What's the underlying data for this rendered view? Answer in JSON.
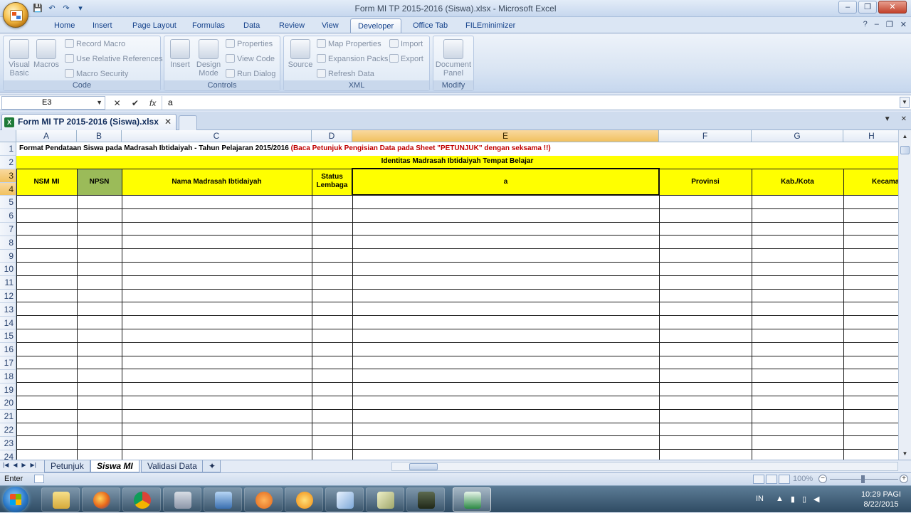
{
  "window": {
    "title": "Form MI TP 2015-2016 (Siswa).xlsx - Microsoft Excel",
    "qat_save": "💾",
    "qat_undo": "↶",
    "qat_redo": "↷",
    "qat_more": "▾",
    "minimize": "–",
    "restore": "❐",
    "close": "✕"
  },
  "ribbon_tabs": [
    "Home",
    "Insert",
    "Page Layout",
    "Formulas",
    "Data",
    "Review",
    "View",
    "Developer",
    "Office Tab",
    "FILEminimizer"
  ],
  "active_tab": "Developer",
  "ribbon": {
    "code": {
      "label": "Code",
      "visual_basic": "Visual Basic",
      "macros": "Macros",
      "record_macro": "Record Macro",
      "relative_refs": "Use Relative References",
      "macro_security": "Macro Security"
    },
    "controls": {
      "label": "Controls",
      "insert": "Insert",
      "design_mode": "Design Mode",
      "properties": "Properties",
      "view_code": "View Code",
      "run_dialog": "Run Dialog"
    },
    "xml": {
      "label": "XML",
      "source": "Source",
      "map_properties": "Map Properties",
      "expansion_packs": "Expansion Packs",
      "refresh_data": "Refresh Data",
      "import": "Import",
      "export": "Export"
    },
    "modify": {
      "label": "Modify",
      "document_panel": "Document Panel"
    }
  },
  "formula_bar": {
    "name_box": "E3",
    "value": "a",
    "fx": "fx",
    "cancel": "✕",
    "enter": "✔"
  },
  "doc_tab": {
    "label": "Form MI TP 2015-2016 (Siswa).xlsx",
    "close": "✕"
  },
  "columns": [
    "A",
    "B",
    "C",
    "D",
    "E",
    "F",
    "G",
    "H"
  ],
  "selected_column": "E",
  "rows": [
    "1",
    "2",
    "3",
    "4",
    "5",
    "6",
    "7",
    "8",
    "9",
    "10",
    "11",
    "12",
    "13",
    "14",
    "15",
    "16",
    "17",
    "18",
    "19",
    "20",
    "21",
    "22",
    "23",
    "24"
  ],
  "selected_rows": [
    "3",
    "4"
  ],
  "sheet": {
    "row1_black": "Format Pendataan Siswa pada Madrasah Ibtidaiyah - Tahun Pelajaran 2015/2016 ",
    "row1_red": "(Baca Petunjuk Pengisian Data pada Sheet \"PETUNJUK\" dengan seksama !!)",
    "row2_heading": "Identitas Madrasah Ibtidaiyah Tempat Belajar",
    "headers": {
      "nsm": "NSM MI",
      "npsn": "NPSN",
      "nama": "Nama Madrasah Ibtidaiyah",
      "status": "Status Lembaga",
      "e3": "a",
      "provinsi": "Provinsi",
      "kabkota": "Kab./Kota",
      "kecamatan": "Kecama"
    }
  },
  "sheet_tabs": [
    "Petunjuk",
    "Siswa MI",
    "Validasi Data"
  ],
  "active_sheet": "Siswa MI",
  "status": {
    "mode": "Enter",
    "zoom": "100%"
  },
  "taskbar": {
    "lang": "IN",
    "time": "10:29 PAGI",
    "date": "8/22/2015",
    "apps": [
      "file-explorer",
      "firefox",
      "chrome",
      "network-tool",
      "remote-desktop",
      "uc-browser",
      "burning-tool",
      "notepad-tool",
      "document-tool",
      "media-tool",
      "excel"
    ]
  },
  "colors": {
    "header_yellow": "#ffff00",
    "npsn_green": "#9bbb59",
    "row1_red": "#c00000",
    "selected_header": "#f1c15f"
  }
}
